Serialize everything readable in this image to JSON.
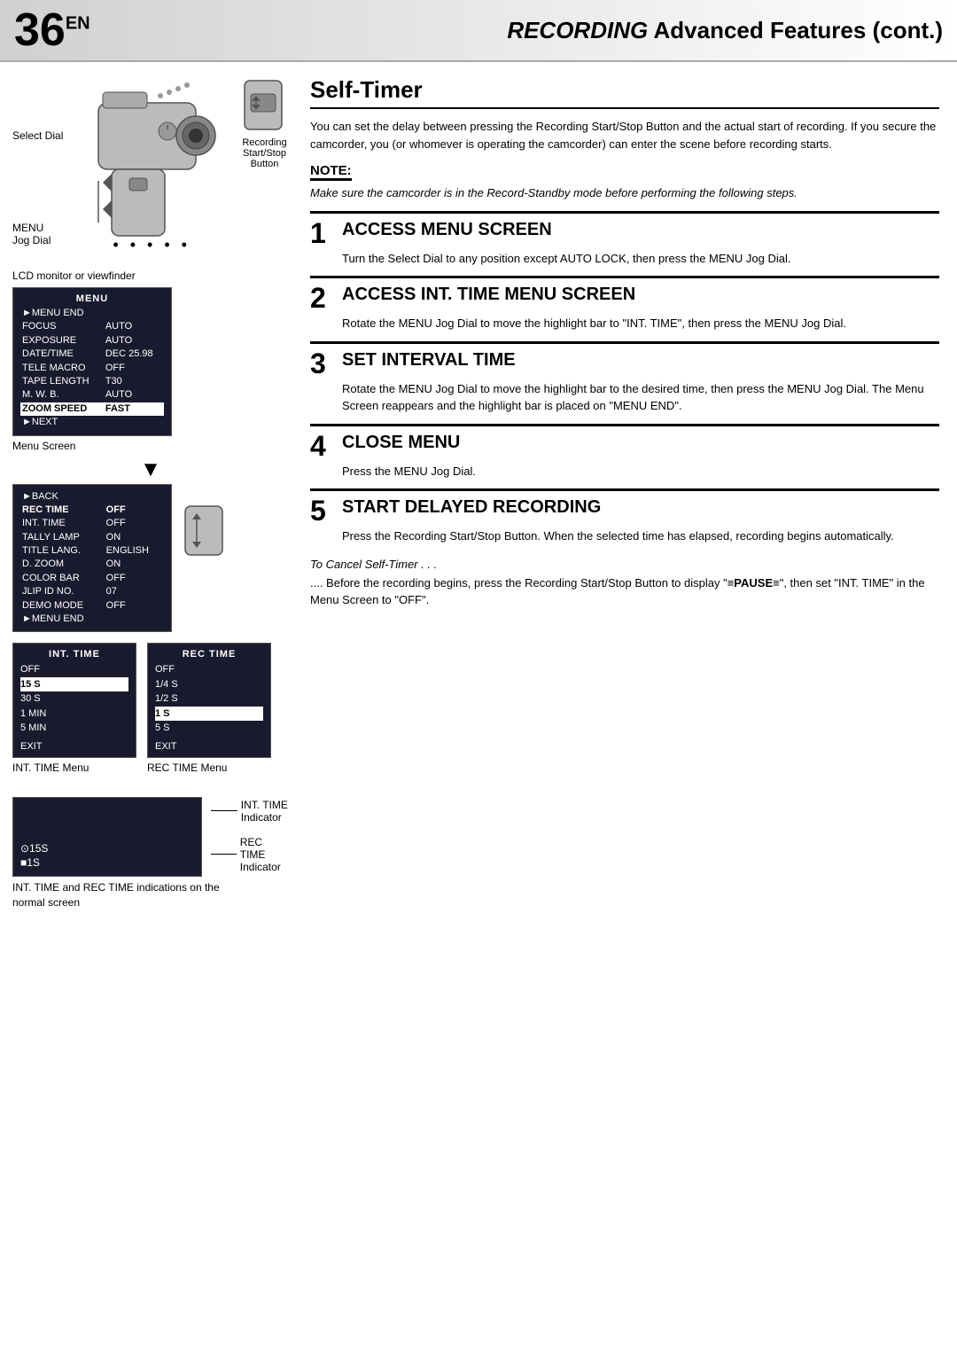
{
  "header": {
    "page_number": "36",
    "page_number_suffix": "EN",
    "title_italic": "RECORDING",
    "title_rest": "Advanced Features (cont.)"
  },
  "left_column": {
    "camcorder_labels": {
      "select_dial": "Select Dial",
      "menu_jog_dial": "MENU\nJog Dial",
      "recording_start_stop": "Recording\nStart/Stop\nButton"
    },
    "lcd_label": "LCD monitor or viewfinder",
    "menu_screen": {
      "title": "MENU",
      "rows": [
        {
          "label": "►MENU END",
          "value": ""
        },
        {
          "label": "FOCUS",
          "value": "AUTO"
        },
        {
          "label": "EXPOSURE",
          "value": "AUTO"
        },
        {
          "label": "DATE/TIME",
          "value": "DEC 25.98"
        },
        {
          "label": "TELE MACRO",
          "value": "OFF"
        },
        {
          "label": "TAPE LENGTH",
          "value": "T30"
        },
        {
          "label": "M. W. B.",
          "value": "AUTO"
        },
        {
          "label": "ZOOM SPEED",
          "value": "FAST",
          "highlight": true
        },
        {
          "label": "►NEXT",
          "value": ""
        }
      ],
      "section_label": "Menu Screen"
    },
    "menu_screen2": {
      "rows": [
        {
          "label": "►BACK",
          "value": ""
        },
        {
          "label": "REC TIME",
          "value": "OFF",
          "bold": true
        },
        {
          "label": "INT. TIME",
          "value": "OFF"
        },
        {
          "label": "TALLY LAMP",
          "value": "ON"
        },
        {
          "label": "TITLE LANG.",
          "value": "ENGLISH"
        },
        {
          "label": "D. ZOOM",
          "value": "ON"
        },
        {
          "label": "COLOR BAR",
          "value": "OFF"
        },
        {
          "label": "JLIP ID NO.",
          "value": "07"
        },
        {
          "label": "DEMO MODE",
          "value": "OFF"
        },
        {
          "label": "►MENU END",
          "value": ""
        }
      ]
    },
    "int_time_menu": {
      "title": "INT. TIME",
      "items": [
        "OFF",
        "15 S",
        "30 S",
        "1 MIN",
        "5 MIN"
      ],
      "selected": "15 S",
      "exit": "EXIT",
      "label": "INT. TIME Menu"
    },
    "rec_time_menu": {
      "title": "REC TIME",
      "items": [
        "OFF",
        "1/4 S",
        "1/2 S",
        "1 S",
        "5 S"
      ],
      "selected": "1 S",
      "exit": "EXIT",
      "label": "REC TIME Menu"
    },
    "normal_screen": {
      "indicator1_text": "⊙15S",
      "indicator2_text": "■1S",
      "int_time_label": "INT. TIME\nIndicator",
      "rec_time_label": "REC TIME\nIndicator"
    },
    "bottom_caption": "INT. TIME and REC TIME indications on the\nnormal screen"
  },
  "right_column": {
    "section_title": "Self-Timer",
    "intro_text": "You can set the delay between pressing the Recording Start/Stop Button and the actual start of recording. If you secure the camcorder, you (or whomever is operating the camcorder) can enter the scene before recording starts.",
    "note": {
      "title": "NOTE:",
      "text": "Make sure the camcorder is in the Record-Standby mode before performing the following steps."
    },
    "steps": [
      {
        "number": "1",
        "title": "ACCESS MENU SCREEN",
        "body": "Turn the Select Dial to any position except AUTO LOCK, then press the MENU Jog Dial."
      },
      {
        "number": "2",
        "title": "ACCESS INT. TIME MENU SCREEN",
        "body": "Rotate the MENU Jog Dial to move the highlight bar to \"INT. TIME\", then press the MENU Jog Dial."
      },
      {
        "number": "3",
        "title": "SET INTERVAL TIME",
        "body": "Rotate the MENU Jog Dial to move the highlight bar to the desired time, then press the MENU Jog Dial. The Menu Screen reappears and the highlight bar is placed on \"MENU END\"."
      },
      {
        "number": "4",
        "title": "CLOSE MENU",
        "body": "Press the MENU Jog Dial."
      },
      {
        "number": "5",
        "title": "START DELAYED RECORDING",
        "body": "Press the Recording Start/Stop Button. When the selected time has elapsed, recording begins automatically."
      }
    ],
    "cancel_section": {
      "title": "To Cancel Self-Timer . . .",
      "text": ".... Before the recording begins, press the Recording Start/Stop Button to display \"≡PAUSE≡\", then set \"INT. TIME\" in the Menu Screen to \"OFF\"."
    }
  }
}
